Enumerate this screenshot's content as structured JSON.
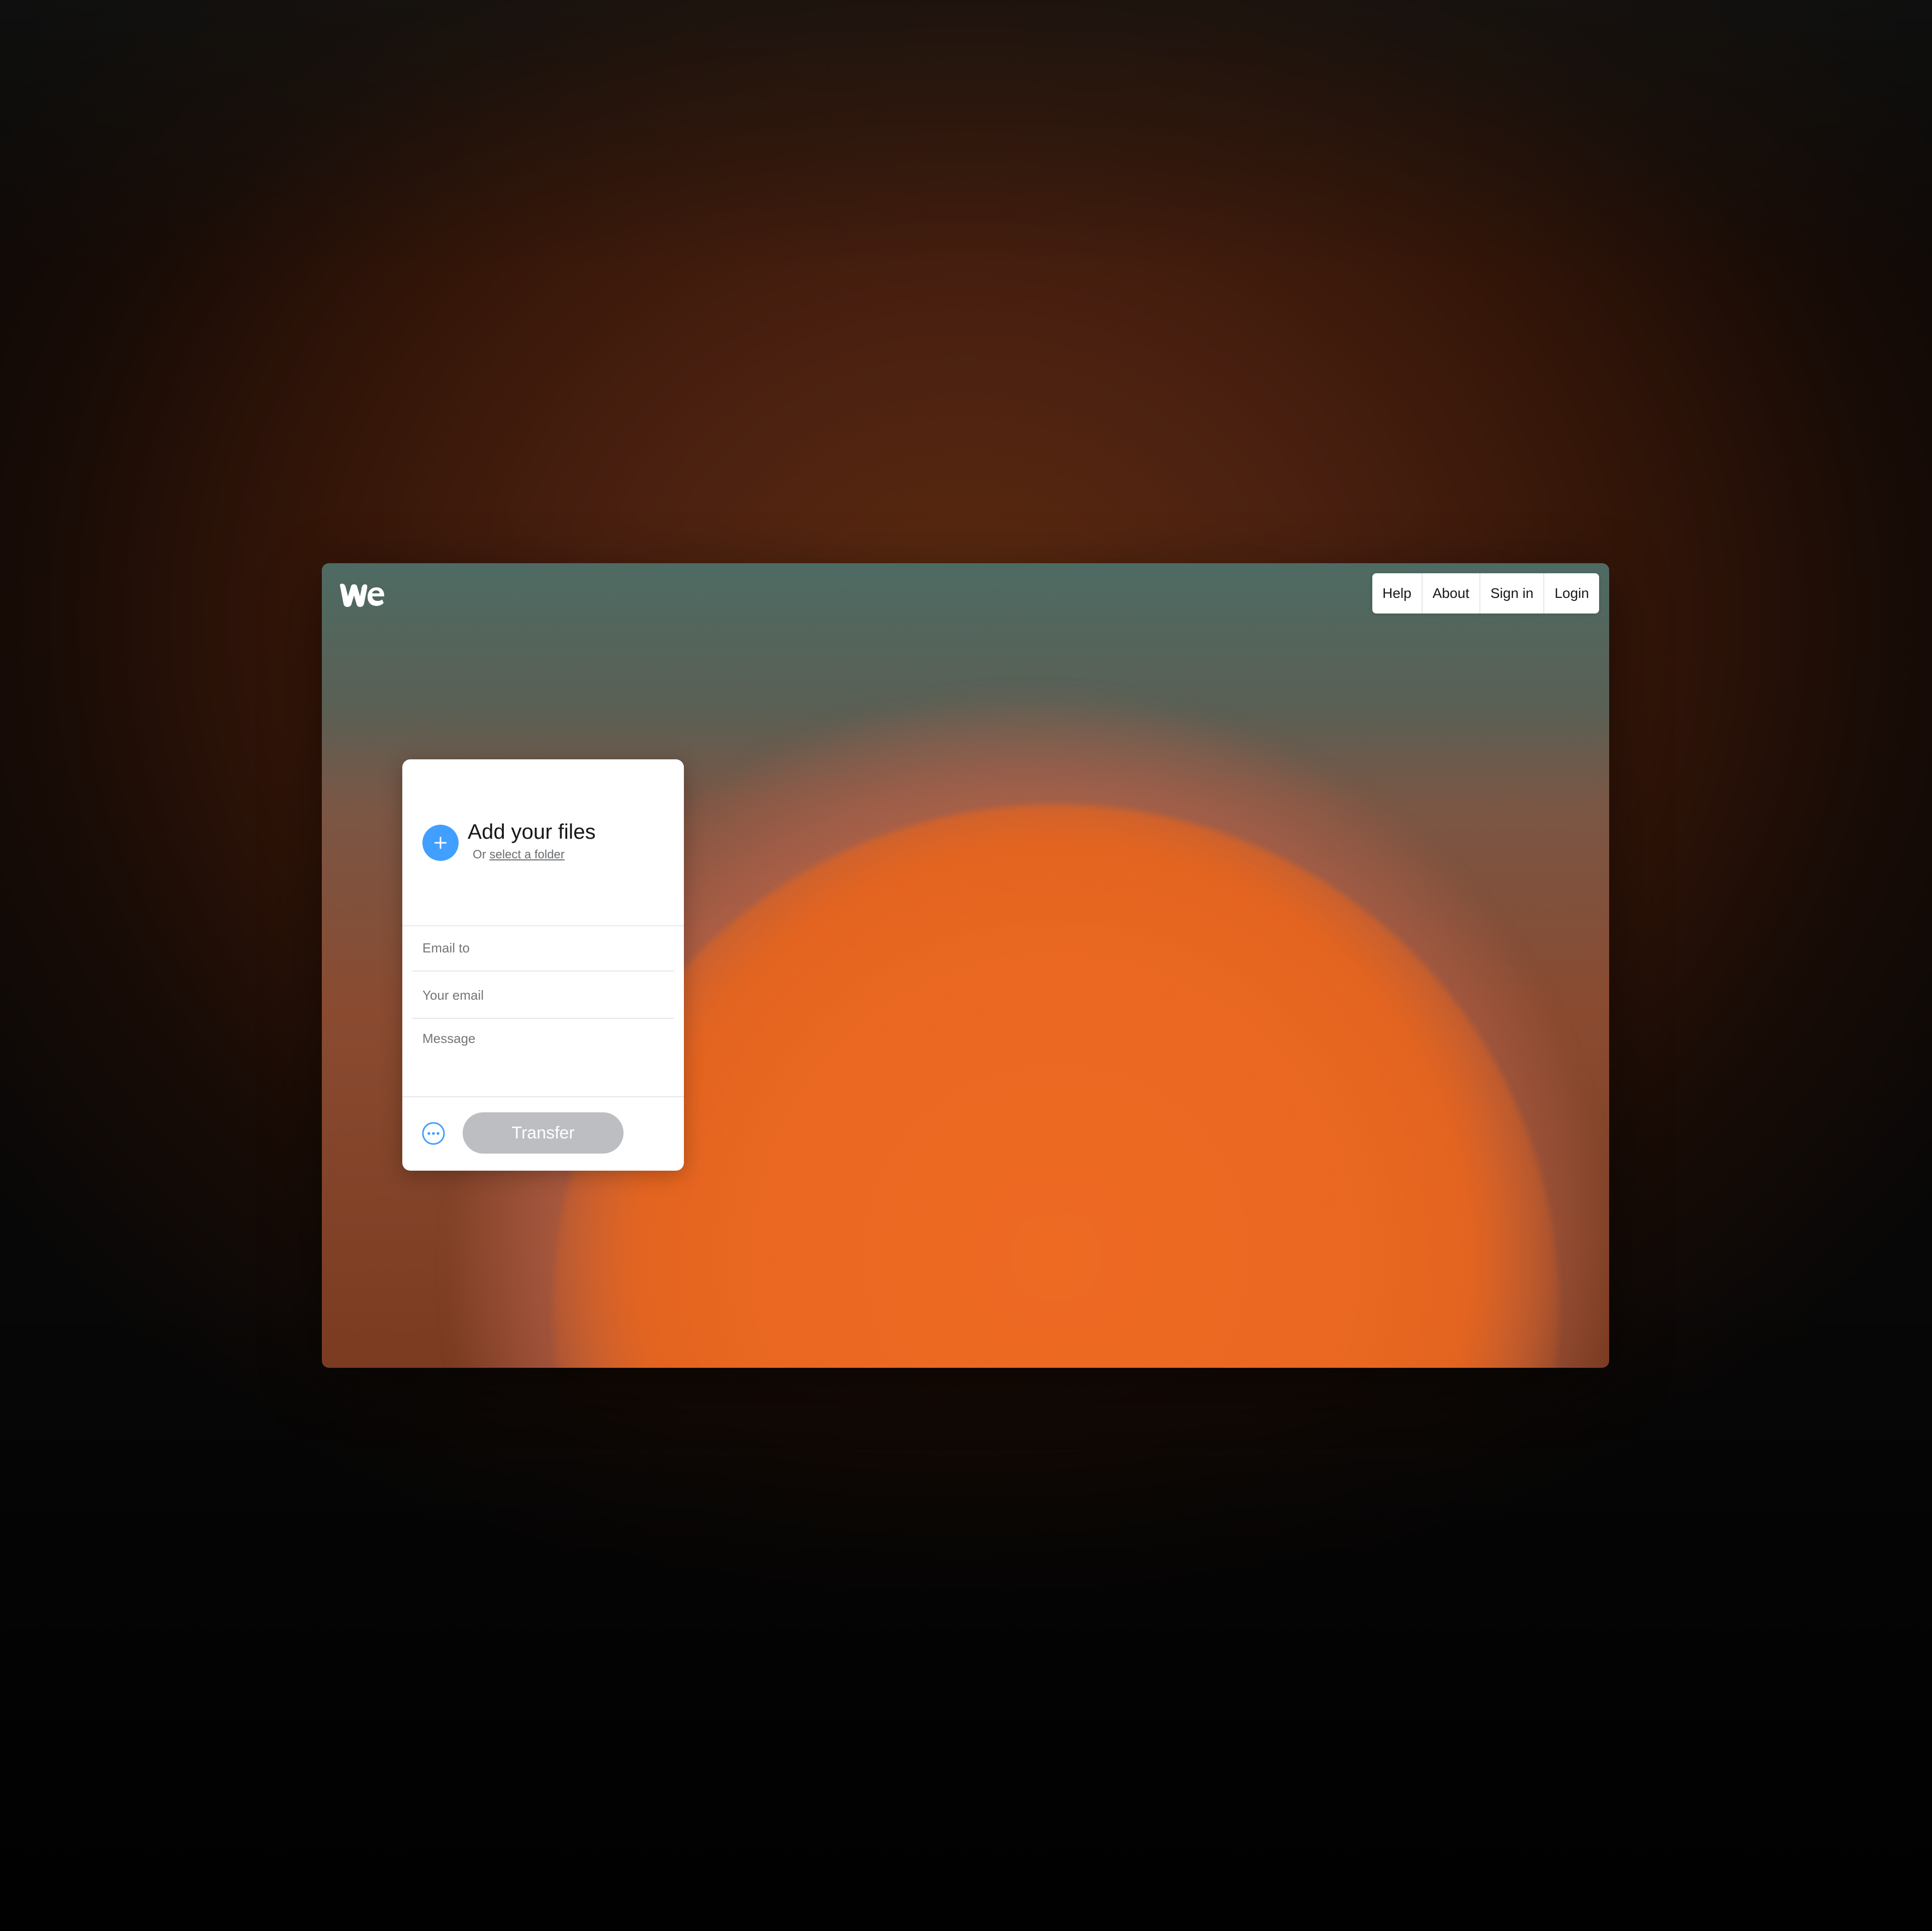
{
  "nav": {
    "items": [
      "Help",
      "About",
      "Sign in",
      "Login"
    ]
  },
  "upload": {
    "title": "Add your files",
    "sub_prefix": "Or",
    "sub_link": "select a folder"
  },
  "form": {
    "email_to_placeholder": "Email to",
    "your_email_placeholder": "Your email",
    "message_placeholder": "Message"
  },
  "footer": {
    "transfer_label": "Transfer"
  },
  "colors": {
    "accent": "#409fff",
    "button_disabled": "#bdbec2",
    "glow": "#ec6820"
  },
  "icons": {
    "logo": "wetransfer-logo",
    "add": "plus-icon",
    "more": "ellipsis-circle-icon"
  }
}
